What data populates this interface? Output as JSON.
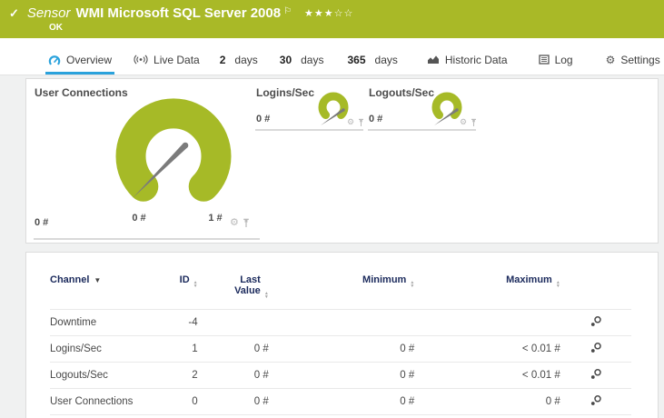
{
  "colors": {
    "banner_green": "#a9b927",
    "gauge_green": "#a6ba27",
    "active_tab_blue": "#2aa2dc",
    "table_header_navy": "#1b2a5c",
    "page_bg": "#f0f1f1",
    "panel_border": "#dcdcdc",
    "needle_gray": "#7b7b7b",
    "muted_icon_gray": "#b9b9b9"
  },
  "icons": {
    "check": "✓",
    "flag": "⚐",
    "gear": "⚙",
    "sort_asc": "▲",
    "sort_desc": "▼"
  },
  "banner": {
    "kind_label": "Sensor",
    "title": "WMI Microsoft SQL Server 2008",
    "status": "OK",
    "rating": "★★★☆☆"
  },
  "tabs": {
    "overview": "Overview",
    "live_data": "Live Data",
    "d2_num": "2",
    "d2_label": "days",
    "d30_num": "30",
    "d30_label": "days",
    "d365_num": "365",
    "d365_label": "days",
    "historic": "Historic Data",
    "log": "Log",
    "settings": "Settings"
  },
  "gauges": {
    "primary": {
      "title": "User Connections",
      "value": "0 #",
      "scale_min": "0 #",
      "scale_max": "1 #"
    },
    "logins": {
      "title": "Logins/Sec",
      "value": "0 #"
    },
    "logouts": {
      "title": "Logouts/Sec",
      "value": "0 #"
    }
  },
  "channels_table": {
    "headers": {
      "channel": "Channel",
      "id": "ID",
      "last_value": "Last Value",
      "minimum": "Minimum",
      "maximum": "Maximum"
    },
    "rows": [
      {
        "channel": "Downtime",
        "id": "-4",
        "last_value": "",
        "minimum": "",
        "maximum": ""
      },
      {
        "channel": "Logins/Sec",
        "id": "1",
        "last_value": "0 #",
        "minimum": "0 #",
        "maximum": "< 0.01 #"
      },
      {
        "channel": "Logouts/Sec",
        "id": "2",
        "last_value": "0 #",
        "minimum": "0 #",
        "maximum": "< 0.01 #"
      },
      {
        "channel": "User Connections",
        "id": "0",
        "last_value": "0 #",
        "minimum": "0 #",
        "maximum": "0 #"
      }
    ]
  }
}
